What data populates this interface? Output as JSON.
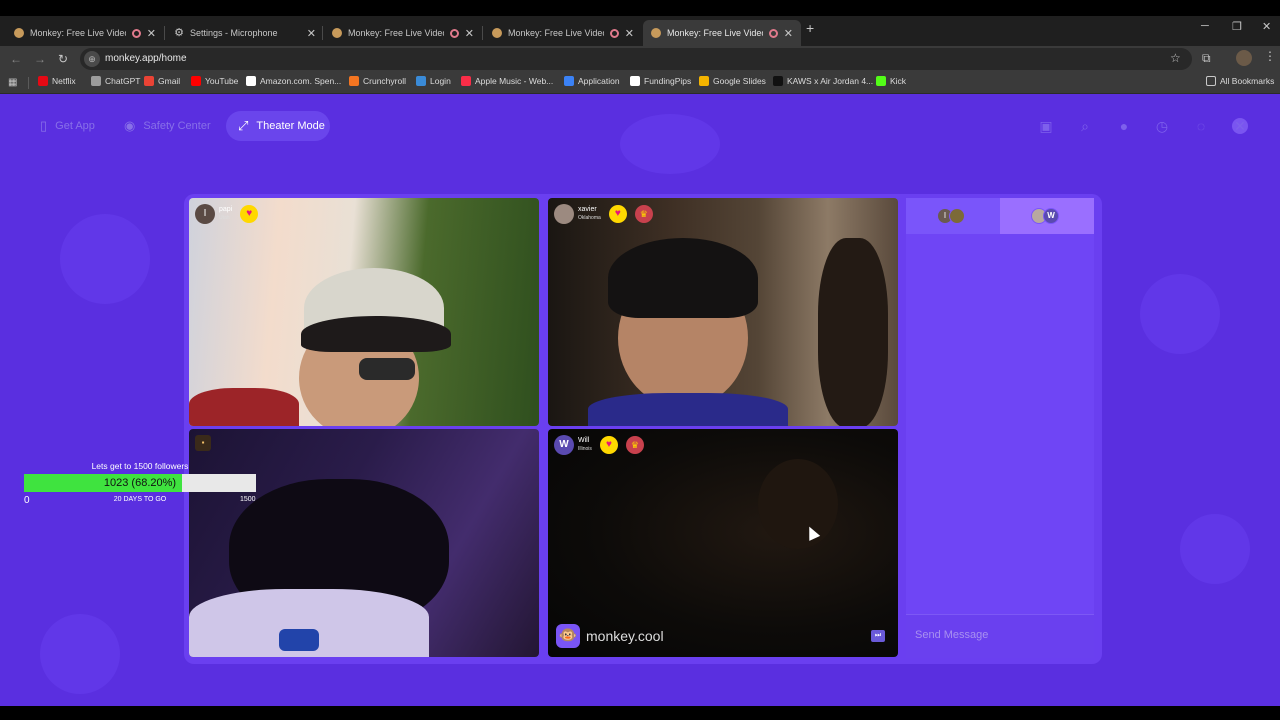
{
  "browser": {
    "tabs": [
      {
        "title": "Monkey: Free Live Video Cł",
        "active": false,
        "recording": true
      },
      {
        "title": "Settings - Microphone",
        "active": false,
        "recording": false
      },
      {
        "title": "Monkey: Free Live Video Cł",
        "active": false,
        "recording": true
      },
      {
        "title": "Monkey: Free Live Video Cł",
        "active": false,
        "recording": true
      },
      {
        "title": "Monkey: Free Live Video Cł",
        "active": true,
        "recording": true
      }
    ],
    "url": "monkey.app/home",
    "bookmarks": [
      "Netflix",
      "ChatGPT",
      "Gmail",
      "YouTube",
      "Amazon.com. Spen...",
      "Crunchyroll",
      "Login",
      "Apple Music - Web...",
      "Application",
      "FundingPips",
      "Google Slides",
      "KAWS x Air Jordan 4...",
      "Kick"
    ],
    "all_bookmarks": "All Bookmarks",
    "bookmark_colors": [
      "#e50914",
      "#9c9c9c",
      "#ea4335",
      "#ff0000",
      "#ffffff",
      "#f47521",
      "#3a8bd8",
      "#fa2d48",
      "#3b82f6",
      "#ffffff",
      "#f4b400",
      "#111111",
      "#53fc18"
    ]
  },
  "topnav": {
    "get_app": "Get App",
    "safety_center": "Safety Center",
    "theater_mode": "Theater Mode"
  },
  "tiles": [
    {
      "name": "papi",
      "location": "Utah",
      "initial": "I"
    },
    {
      "name": "xavier",
      "location": "Oklahoma",
      "initial": ""
    },
    {
      "name": "",
      "location": "",
      "initial": ""
    },
    {
      "name": "Will",
      "location": "Illinois",
      "initial": "W"
    }
  ],
  "chat": {
    "tab1_initial": "I",
    "tab2_initial": "W",
    "placeholder": "Send Message"
  },
  "branding": {
    "logo_text": "monkey.cool"
  },
  "followers": {
    "title": "Lets get to 1500 followers",
    "current_label": "1023 (68.20%)",
    "progress_fraction": 0.682,
    "min": "0",
    "max": "1500",
    "days_label": "20 DAYS TO GO"
  },
  "colors": {
    "page_bg": "#5a2fe0",
    "accent_heart": "#ffd800",
    "progress_green": "#3fe33f"
  }
}
